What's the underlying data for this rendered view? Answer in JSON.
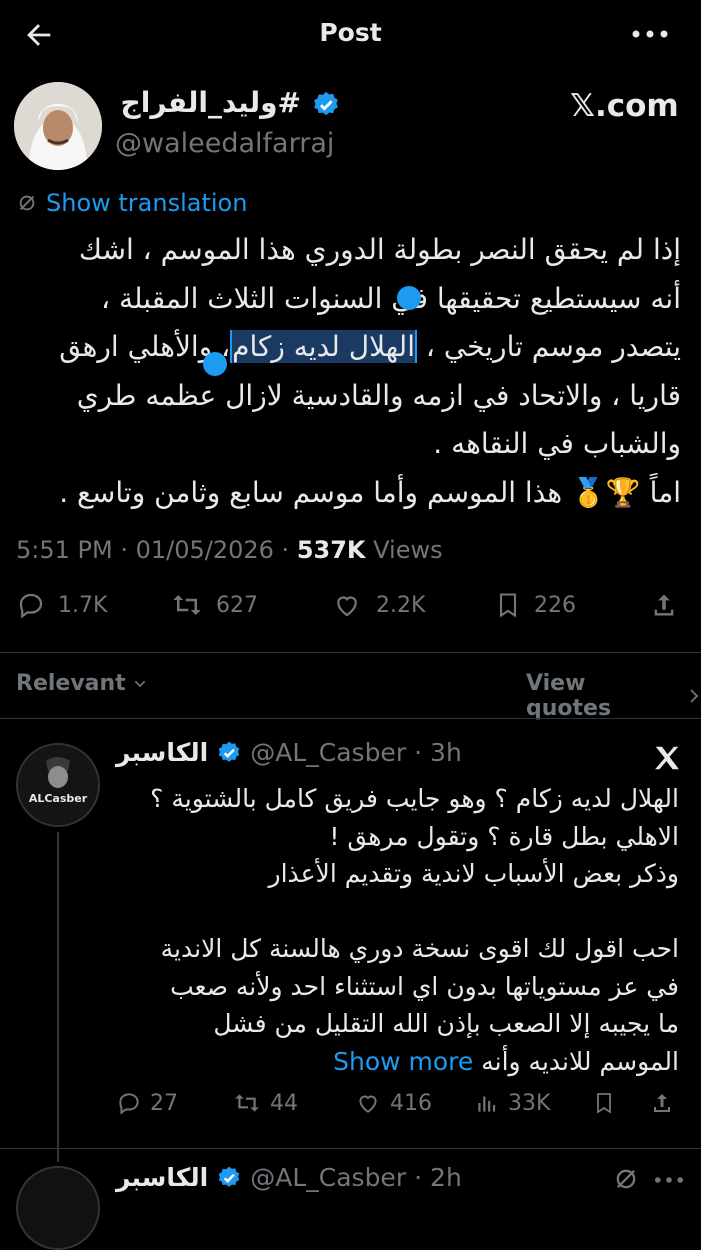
{
  "header": {
    "title": "Post"
  },
  "post": {
    "author_name": "#وليد_الفراج",
    "author_handle": "@waleedalfarraj",
    "brand": "𝕏.com",
    "translate_label": "Show translation",
    "body_lines": [
      "إذا لم يحقق النصر بطولة الدوري هذا الموسم ، اشك",
      "أنه سيستطيع تحقيقها في السنوات الثلاث المقبلة ،",
      "يتصدر موسم تاريخي ، ",
      "الهلال لديه زكام",
      "، والأهلي ارهق",
      "قاريا ، والاتحاد في ازمه والقادسية لازال عظمه طري",
      "والشباب في النقاهه .",
      "اماً 🏆🥇 هذا الموسم وأما موسم سابع وثامن وتاسع ."
    ],
    "time": "5:51 PM",
    "date": "01/05/2026",
    "views_count": "537K",
    "views_label": "Views",
    "stats": {
      "replies": "1.7K",
      "reposts": "627",
      "likes": "2.2K",
      "bookmarks": "226"
    }
  },
  "filter": {
    "sort_label": "Relevant",
    "quotes_label": "View quotes"
  },
  "replies": [
    {
      "name": "الكاسبر",
      "handle": "@AL_Casber",
      "age": "3h",
      "avatar_text": "ALCasber",
      "body": "الهلال لديه زكام ؟ وهو جايب فريق كامل بالشتوية ؟\nالاهلي بطل قارة ؟ وتقول مرهق !\nوذكر بعض الأسباب لاندية وتقديم الأعذار\n\nاحب اقول لك اقوى نسخة دوري هالسنة كل الاندية\nفي عز مستوياتها بدون اي استثناء احد ولأنه صعب\nما يجيبه إلا الصعب بإذن الله التقليل من فشل\nالموسم للانديه وأنه ",
      "show_more": "Show more",
      "stats": {
        "replies": "27",
        "reposts": "44",
        "likes": "416",
        "views": "33K"
      }
    },
    {
      "name": "الكاسبر",
      "handle": "@AL_Casber",
      "age": "2h"
    }
  ],
  "colors": {
    "accent": "#1d9bf0",
    "muted": "#71767b",
    "background": "#000000",
    "text": "#e7e9ea"
  }
}
